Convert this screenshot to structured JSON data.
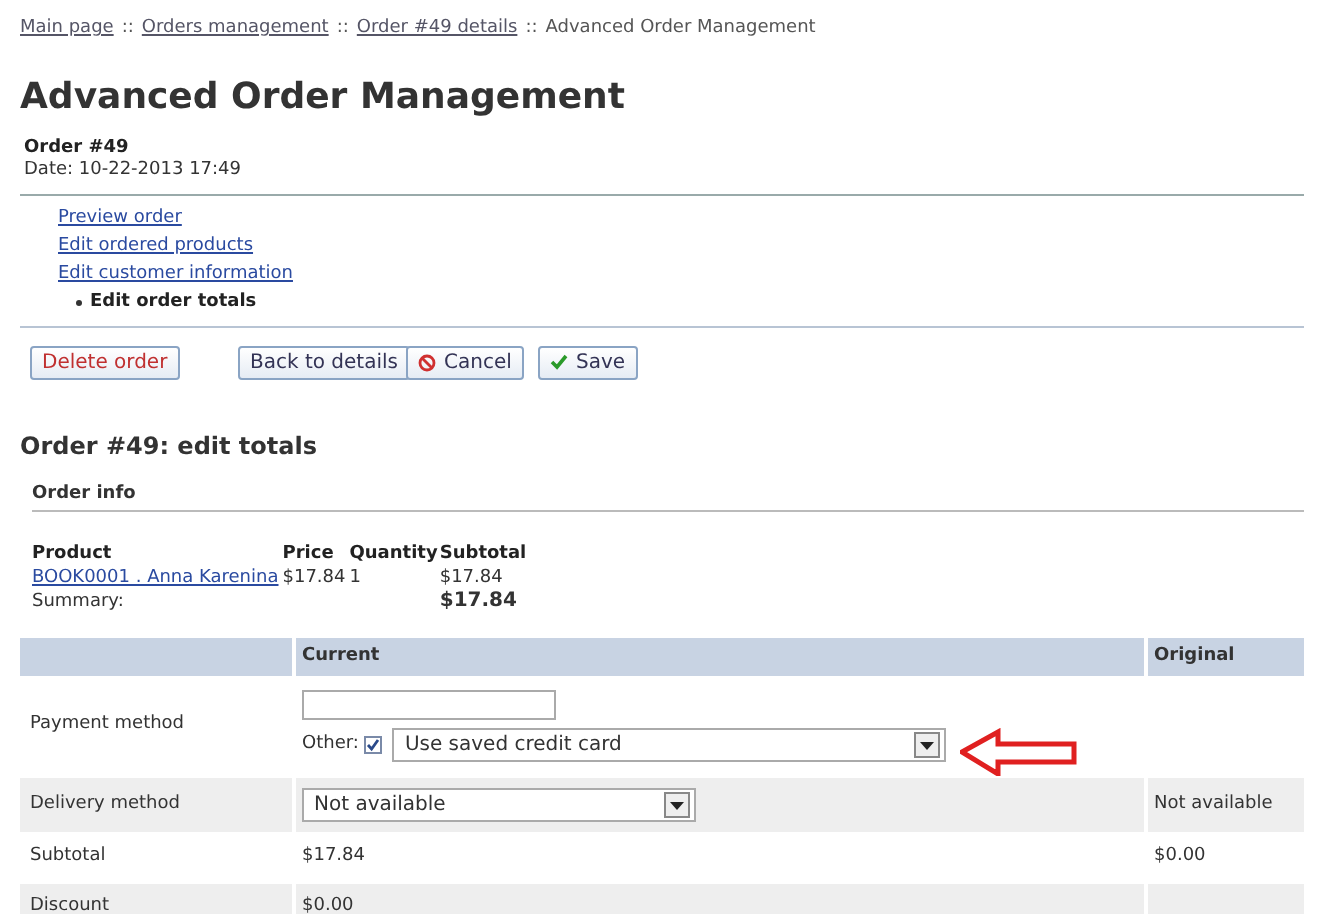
{
  "breadcrumbs": [
    {
      "label": "Main page",
      "link": true
    },
    {
      "label": "Orders management",
      "link": true
    },
    {
      "label": "Order #49 details",
      "link": true
    },
    {
      "label": "Advanced Order Management",
      "link": false
    }
  ],
  "separator": "::",
  "title": "Advanced Order Management",
  "order": {
    "number": "Order #49",
    "date": "Date: 10-22-2013 17:49"
  },
  "nav": [
    {
      "label": "Preview order",
      "selected": false
    },
    {
      "label": "Edit ordered products",
      "selected": false
    },
    {
      "label": "Edit customer information",
      "selected": false
    },
    {
      "label": "Edit order totals",
      "selected": true
    }
  ],
  "buttons": [
    {
      "label": "Delete order",
      "kind": "danger"
    },
    {
      "label": "Back to details",
      "kind": "plain"
    },
    {
      "label": "Cancel",
      "kind": "cancel"
    },
    {
      "label": "Save",
      "kind": "save"
    }
  ],
  "section_title": "Order #49: edit totals",
  "order_info": {
    "title": "Order info",
    "columns": [
      "Product",
      "Price",
      "Quantity",
      "Subtotal"
    ],
    "rows": [
      {
        "product": "BOOK0001 . Anna Karenina",
        "price": "$17.84",
        "quantity": "1",
        "subtotal": "$17.84"
      }
    ],
    "summary_label": "Summary:",
    "summary_value": "$17.84"
  },
  "totals": {
    "columns": [
      "Current",
      "Original"
    ],
    "rows": [
      {
        "kind": "payment",
        "label": "Payment method",
        "other_label": "Other:",
        "other_checked": true,
        "select_value": "Use saved credit card",
        "original": ""
      },
      {
        "kind": "select",
        "label": "Delivery method",
        "select_value": "Not available",
        "original": "Not available"
      },
      {
        "kind": "text",
        "label": "Subtotal",
        "current": "$17.84",
        "original": "$0.00"
      },
      {
        "kind": "text",
        "label": "Discount",
        "current": "$0.00",
        "original": ""
      }
    ]
  }
}
